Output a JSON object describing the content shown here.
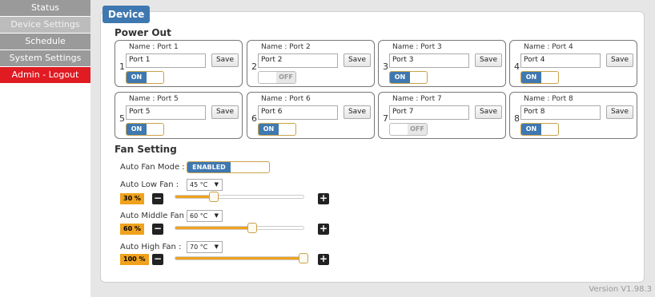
{
  "sidebar": {
    "items": [
      {
        "label": "Status"
      },
      {
        "label": "Device Settings"
      },
      {
        "label": "Schedule"
      },
      {
        "label": "System Settings"
      },
      {
        "label": "Admin - Logout"
      }
    ]
  },
  "panel": {
    "tab": "Device"
  },
  "power_out": {
    "title": "Power Out",
    "save_label": "Save",
    "ports": [
      {
        "number": "1",
        "name_label": "Name : Port 1",
        "value": "Port 1",
        "state": "ON"
      },
      {
        "number": "2",
        "name_label": "Name : Port 2",
        "value": "Port 2",
        "state": "OFF"
      },
      {
        "number": "3",
        "name_label": "Name : Port 3",
        "value": "Port 3",
        "state": "ON"
      },
      {
        "number": "4",
        "name_label": "Name : Port 4",
        "value": "Port 4",
        "state": "ON"
      },
      {
        "number": "5",
        "name_label": "Name : Port 5",
        "value": "Port 5",
        "state": "ON"
      },
      {
        "number": "6",
        "name_label": "Name : Port 6",
        "value": "Port 6",
        "state": "ON"
      },
      {
        "number": "7",
        "name_label": "Name : Port 7",
        "value": "Port 7",
        "state": "OFF"
      },
      {
        "number": "8",
        "name_label": "Name : Port 8",
        "value": "Port 8",
        "state": "ON"
      }
    ]
  },
  "fan": {
    "title": "Fan Setting",
    "mode_label": "Auto Fan Mode :",
    "mode_value": "ENABLED",
    "low": {
      "label": "Auto Low Fan :",
      "temp": "45 °C",
      "pct": "30 %",
      "level": 0.3
    },
    "middle": {
      "label": "Auto Middle Fan :",
      "temp": "60 °C",
      "pct": "60 %",
      "level": 0.6
    },
    "high": {
      "label": "Auto High Fan :",
      "temp": "70 °C",
      "pct": "100 %",
      "level": 1.0
    },
    "minus": "−",
    "plus": "+"
  },
  "footer": {
    "version": "Version V1.98.3"
  },
  "colors": {
    "accent": "#3f78b0",
    "orange": "#f0a21d",
    "logout": "#e01b22"
  }
}
